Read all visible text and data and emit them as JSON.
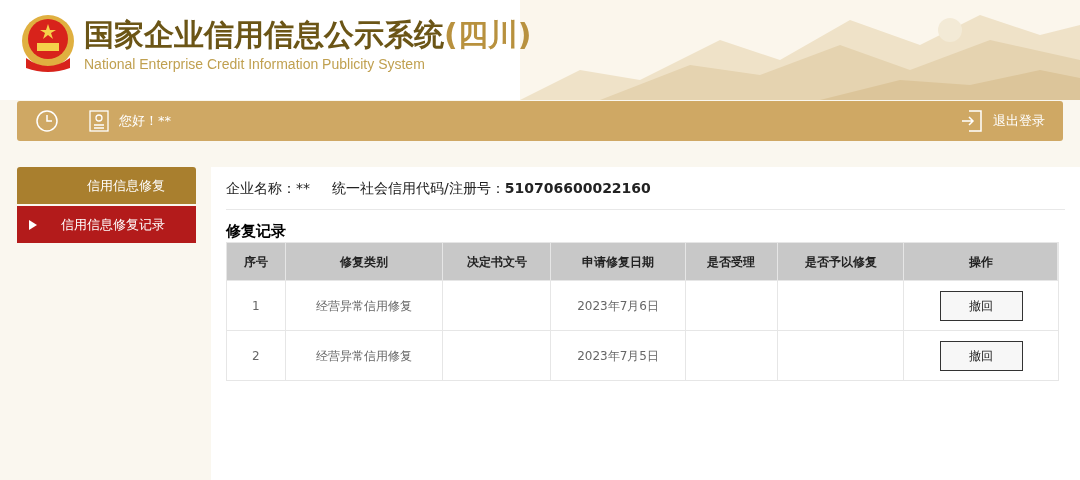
{
  "header": {
    "title": "国家企业信用信息公示系统",
    "region": "(四川)",
    "subtitle": "National Enterprise Credit Information Publicity System"
  },
  "toolbar": {
    "greeting": "您好！**",
    "logout": "退出登录"
  },
  "sidebar": {
    "items": [
      {
        "label": "信用信息修复",
        "kind": "group",
        "selected": false
      },
      {
        "label": "信用信息修复记录",
        "kind": "link",
        "selected": true
      }
    ]
  },
  "company": {
    "name_label": "企业名称：**",
    "code_label": "统一社会信用代码/注册号：",
    "code": "510706600022160"
  },
  "section_title": "修复记录",
  "table": {
    "columns": [
      "序号",
      "修复类别",
      "决定书文号",
      "申请修复日期",
      "是否受理",
      "是否予以修复",
      "操作"
    ],
    "rows": [
      {
        "cells": [
          "1",
          "经营异常信用修复",
          "",
          "2023年7月6日",
          "",
          ""
        ],
        "action": "撤回"
      },
      {
        "cells": [
          "2",
          "经营异常信用修复",
          "",
          "2023年7月5日",
          "",
          ""
        ],
        "action": "撤回"
      }
    ]
  }
}
